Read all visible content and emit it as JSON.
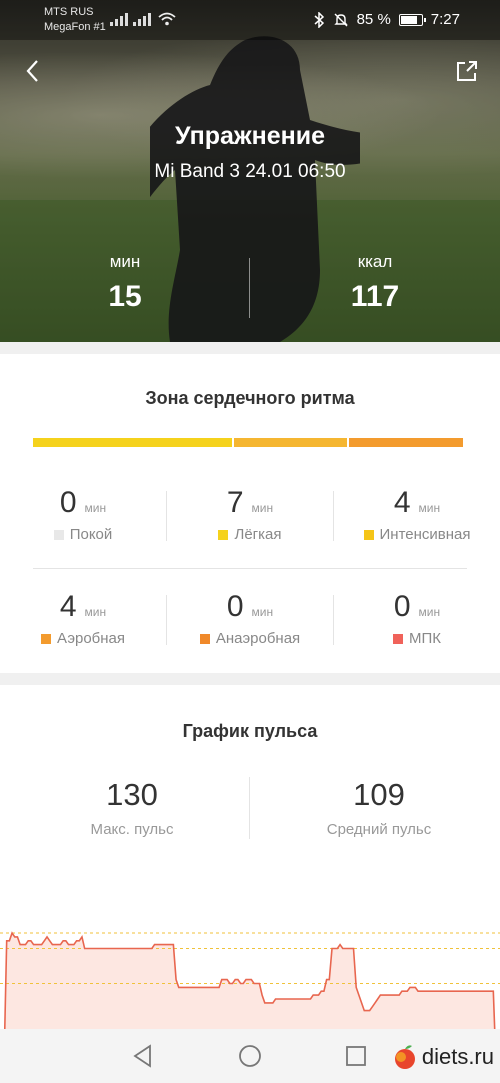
{
  "status": {
    "carrier1": "MTS RUS",
    "carrier2": "MegaFon #1",
    "battery": "85 %",
    "battery_level": 0.85,
    "time": "7:27"
  },
  "hero": {
    "title": "Упражнение",
    "subtitle": "Mi Band 3 24.01 06:50",
    "left_unit": "мин",
    "left_value": "15",
    "right_unit": "ккал",
    "right_value": "117"
  },
  "zones": {
    "title": "Зона сердечного ритма",
    "bar_segments": [
      {
        "color": "#f5d21c",
        "share": 0.467
      },
      {
        "color": "#f5b631",
        "share": 0.267
      },
      {
        "color": "#f39b2e",
        "share": 0.266
      }
    ],
    "unit": "мин",
    "items": [
      {
        "value": "0",
        "label": "Покой",
        "color": "#e8e8e8"
      },
      {
        "value": "7",
        "label": "Лёгкая",
        "color": "#f5d21c"
      },
      {
        "value": "4",
        "label": "Интенсивная",
        "color": "#f5c518"
      },
      {
        "value": "4",
        "label": "Аэробная",
        "color": "#f39b2e"
      },
      {
        "value": "0",
        "label": "Анаэробная",
        "color": "#f0892a"
      },
      {
        "value": "0",
        "label": "МПК",
        "color": "#f0625a"
      }
    ]
  },
  "pulse": {
    "title": "График пульса",
    "max_value": "130",
    "max_label": "Макс. пульс",
    "avg_value": "109",
    "avg_label": "Средний пульс"
  },
  "chart_data": {
    "type": "area",
    "y": [
      96,
      128,
      128,
      130,
      129,
      129,
      127,
      127,
      127,
      128,
      128,
      127,
      127,
      127,
      127,
      128,
      129,
      128,
      127,
      127,
      127,
      127,
      128,
      128,
      127,
      127,
      127,
      128,
      128,
      129,
      126,
      126,
      126,
      126,
      126,
      126,
      126,
      126,
      126,
      126,
      126,
      126,
      126,
      126,
      126,
      126,
      126,
      126,
      126,
      126,
      126,
      126,
      126,
      126,
      126,
      126,
      127,
      127,
      127,
      127,
      127,
      127,
      127,
      127,
      118,
      116,
      116,
      116,
      116,
      116,
      116,
      116,
      116,
      116,
      116,
      116,
      116,
      116,
      116,
      116,
      116,
      118,
      118,
      118,
      117,
      117,
      118,
      118,
      117,
      117,
      118,
      118,
      118,
      117,
      117,
      117,
      114,
      112,
      112,
      112,
      112,
      113,
      113,
      113,
      113,
      113,
      113,
      113,
      113,
      113,
      113,
      113,
      113,
      113,
      113,
      114,
      114,
      114,
      115,
      115,
      118,
      118,
      126,
      126,
      126,
      127,
      126,
      126,
      126,
      126,
      126,
      116,
      114,
      112,
      110,
      110,
      110,
      111,
      112,
      113,
      114,
      114,
      114,
      114,
      114,
      114,
      114,
      114,
      115,
      115,
      115,
      116,
      116,
      116,
      115,
      115,
      115,
      115,
      115,
      115,
      115,
      115,
      115,
      115,
      115,
      115,
      115,
      115,
      115,
      115,
      115,
      115,
      115,
      115,
      115,
      115,
      115,
      115,
      115,
      115,
      115,
      115,
      115,
      96
    ],
    "reference_lines": [
      130,
      126,
      117
    ],
    "colors": {
      "line": "#e8664f",
      "fill": "#fde3dc",
      "ref": "#f0c23a"
    }
  },
  "icons": {
    "back": "back-arrow-icon",
    "share": "share-icon"
  }
}
